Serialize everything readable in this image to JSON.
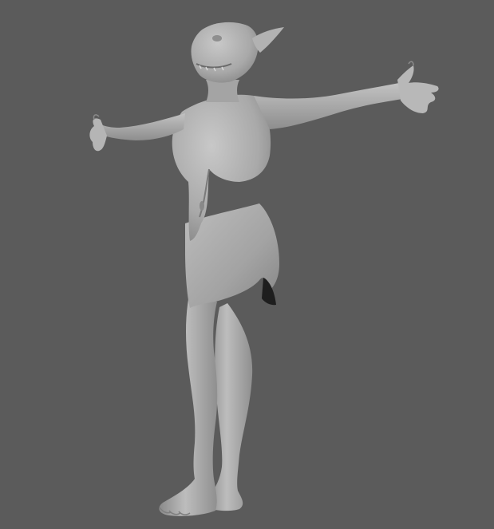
{
  "scene": {
    "subject": "goblin-character-model",
    "pose": "t-pose",
    "colors": {
      "background": "#5b5b5b",
      "clay": "#a8a8a8",
      "clay_light": "#c4c4c4",
      "clay_shadow": "#7a7a7a",
      "deep_shadow": "#1e1e1e"
    }
  }
}
